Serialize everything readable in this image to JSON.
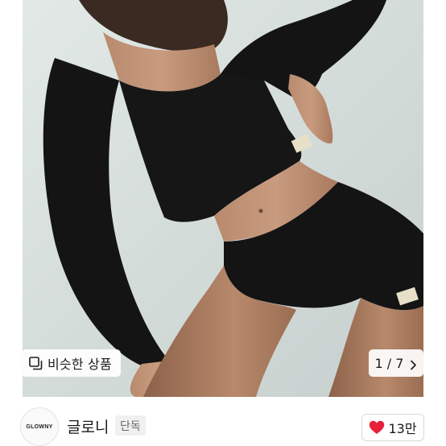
{
  "product_image": {
    "alt": "",
    "current_index": "1 / 7"
  },
  "similar_button": {
    "label": "비슷한 상품",
    "icon": "similar-products-icon"
  },
  "seller": {
    "logo_text": "GLOWNY",
    "name": "글로니",
    "badge": "단독"
  },
  "like": {
    "count": "13만",
    "icon": "heart-icon",
    "color": "#e8203a"
  }
}
